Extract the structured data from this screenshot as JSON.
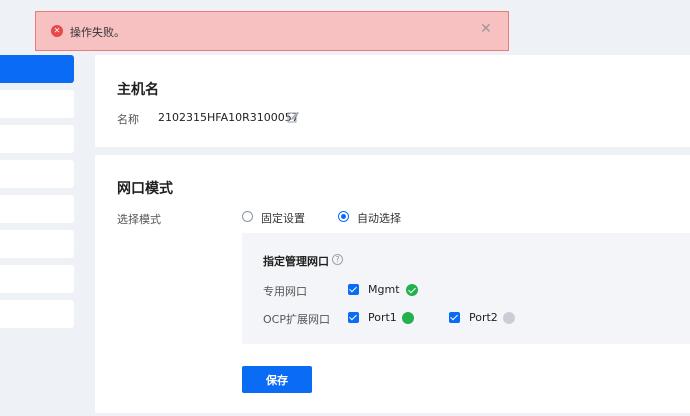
{
  "toast": {
    "message": "操作失败。",
    "error_icon": "error-circle-icon",
    "close_icon": "close-icon"
  },
  "sidebar": {
    "items": [
      {
        "active": true
      },
      {
        "active": false
      },
      {
        "active": false
      },
      {
        "active": false
      },
      {
        "active": false
      },
      {
        "active": false
      },
      {
        "active": false
      },
      {
        "active": false
      }
    ]
  },
  "hostname": {
    "title": "主机名",
    "name_label": "名称",
    "name_value": "2102315HFA10R3100057",
    "edit_icon": "edit-icon"
  },
  "port_mode": {
    "title": "网口模式",
    "select_label": "选择模式",
    "options": [
      {
        "label": "固定设置",
        "checked": false
      },
      {
        "label": "自动选择",
        "checked": true
      }
    ],
    "management": {
      "title": "指定管理网口",
      "help_icon": "help-circle-icon",
      "help_glyph": "?",
      "dedicated_label": "专用网口",
      "dedicated_ports": [
        {
          "name": "Mgmt",
          "checked": true,
          "status": "ok"
        }
      ],
      "ocp_label": "OCP扩展网口",
      "ocp_ports": [
        {
          "name": "Port1",
          "checked": true,
          "status": "green"
        },
        {
          "name": "Port2",
          "checked": true,
          "status": "grey"
        }
      ]
    },
    "save_label": "保存"
  },
  "colors": {
    "accent": "#0a6cf5",
    "error_bg": "#f8c1c1",
    "error_border": "#ea7c7c",
    "error_icon": "#e84848",
    "status_green": "#22b14c",
    "status_grey": "#c9ced6"
  }
}
